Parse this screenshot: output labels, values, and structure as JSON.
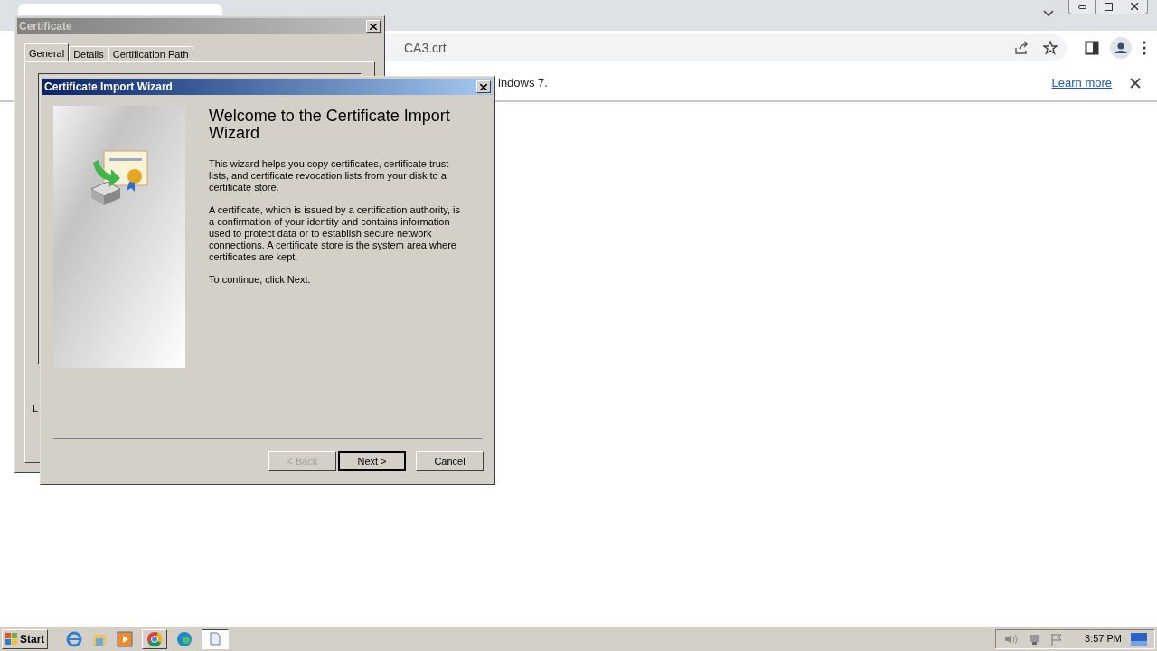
{
  "browser": {
    "address_bar": {
      "value": "CA3.crt"
    },
    "info_bar": {
      "message": "indows 7.",
      "link": "Learn more"
    }
  },
  "certificate_window": {
    "title": "Certificate",
    "active": false,
    "tabs": [
      {
        "label": "General",
        "selected": true
      },
      {
        "label": "Details",
        "selected": false
      },
      {
        "label": "Certification Path",
        "selected": false
      }
    ],
    "footer_text": "L"
  },
  "wizard": {
    "title": "Certificate Import Wizard",
    "active": true,
    "heading": "Welcome to the Certificate Import Wizard",
    "paragraphs": [
      "This wizard helps you copy certificates, certificate trust lists, and certificate revocation lists from your disk to a certificate store.",
      "A certificate, which is issued by a certification authority, is a confirmation of your identity and contains information used to protect data or to establish secure network connections. A certificate store is the system area where certificates are kept.",
      "To continue, click Next."
    ],
    "buttons": [
      {
        "label": "< Back",
        "disabled": true,
        "default": false
      },
      {
        "label": "Next >",
        "disabled": false,
        "default": true
      },
      {
        "label": "Cancel",
        "disabled": false,
        "default": false
      }
    ]
  },
  "taskbar": {
    "start": "Start",
    "clock": "3:57 PM"
  }
}
